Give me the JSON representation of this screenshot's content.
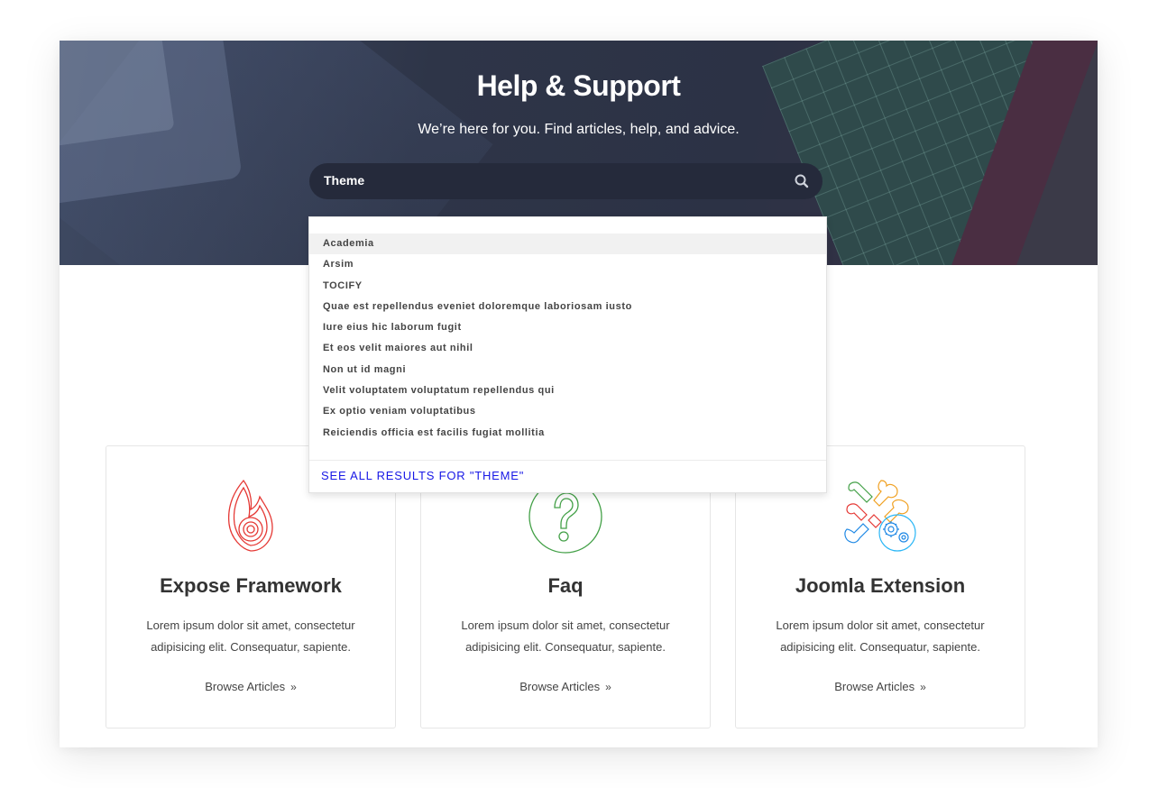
{
  "hero": {
    "title": "Help & Support",
    "subtitle": "We’re here for you. Find articles, help, and advice."
  },
  "search": {
    "value": "Theme",
    "icon": "search-icon"
  },
  "dropdown": {
    "items": [
      "Academia",
      "Arsim",
      "TOCIFY",
      "Quae est repellendus eveniet doloremque laboriosam iusto",
      "Iure eius hic laborum fugit",
      "Et eos velit maiores aut nihil",
      "Non ut id magni",
      "Velit voluptatem voluptatum repellendus qui",
      "Ex optio veniam voluptatibus",
      "Reiciendis officia est facilis fugiat mollitia"
    ],
    "active_index": 0,
    "see_all": "SEE ALL RESULTS FOR \"THEME\""
  },
  "cards": [
    {
      "icon": "flame-icon",
      "title": "Expose Framework",
      "desc_line1": "Lorem ipsum dolor sit amet, consectetur",
      "desc_line2": "adipisicing elit. Consequatur, sapiente.",
      "link": "Browse Articles",
      "icon_color": "#e53935"
    },
    {
      "icon": "question-icon",
      "title": "Faq",
      "desc_line1": "Lorem ipsum dolor sit amet, consectetur",
      "desc_line2": "adipisicing elit. Consequatur, sapiente.",
      "link": "Browse Articles",
      "icon_color": "#43a047"
    },
    {
      "icon": "joomla-gears-icon",
      "title": "Joomla Extension",
      "desc_line1": "Lorem ipsum dolor sit amet, consectetur",
      "desc_line2": "adipisicing elit. Consequatur, sapiente.",
      "link": "Browse Articles",
      "icon_color": "#1e88e5"
    }
  ],
  "colors": {
    "hero_bg": "#2e3548",
    "search_bg": "#252a3b",
    "link_blue": "#1818e6"
  }
}
